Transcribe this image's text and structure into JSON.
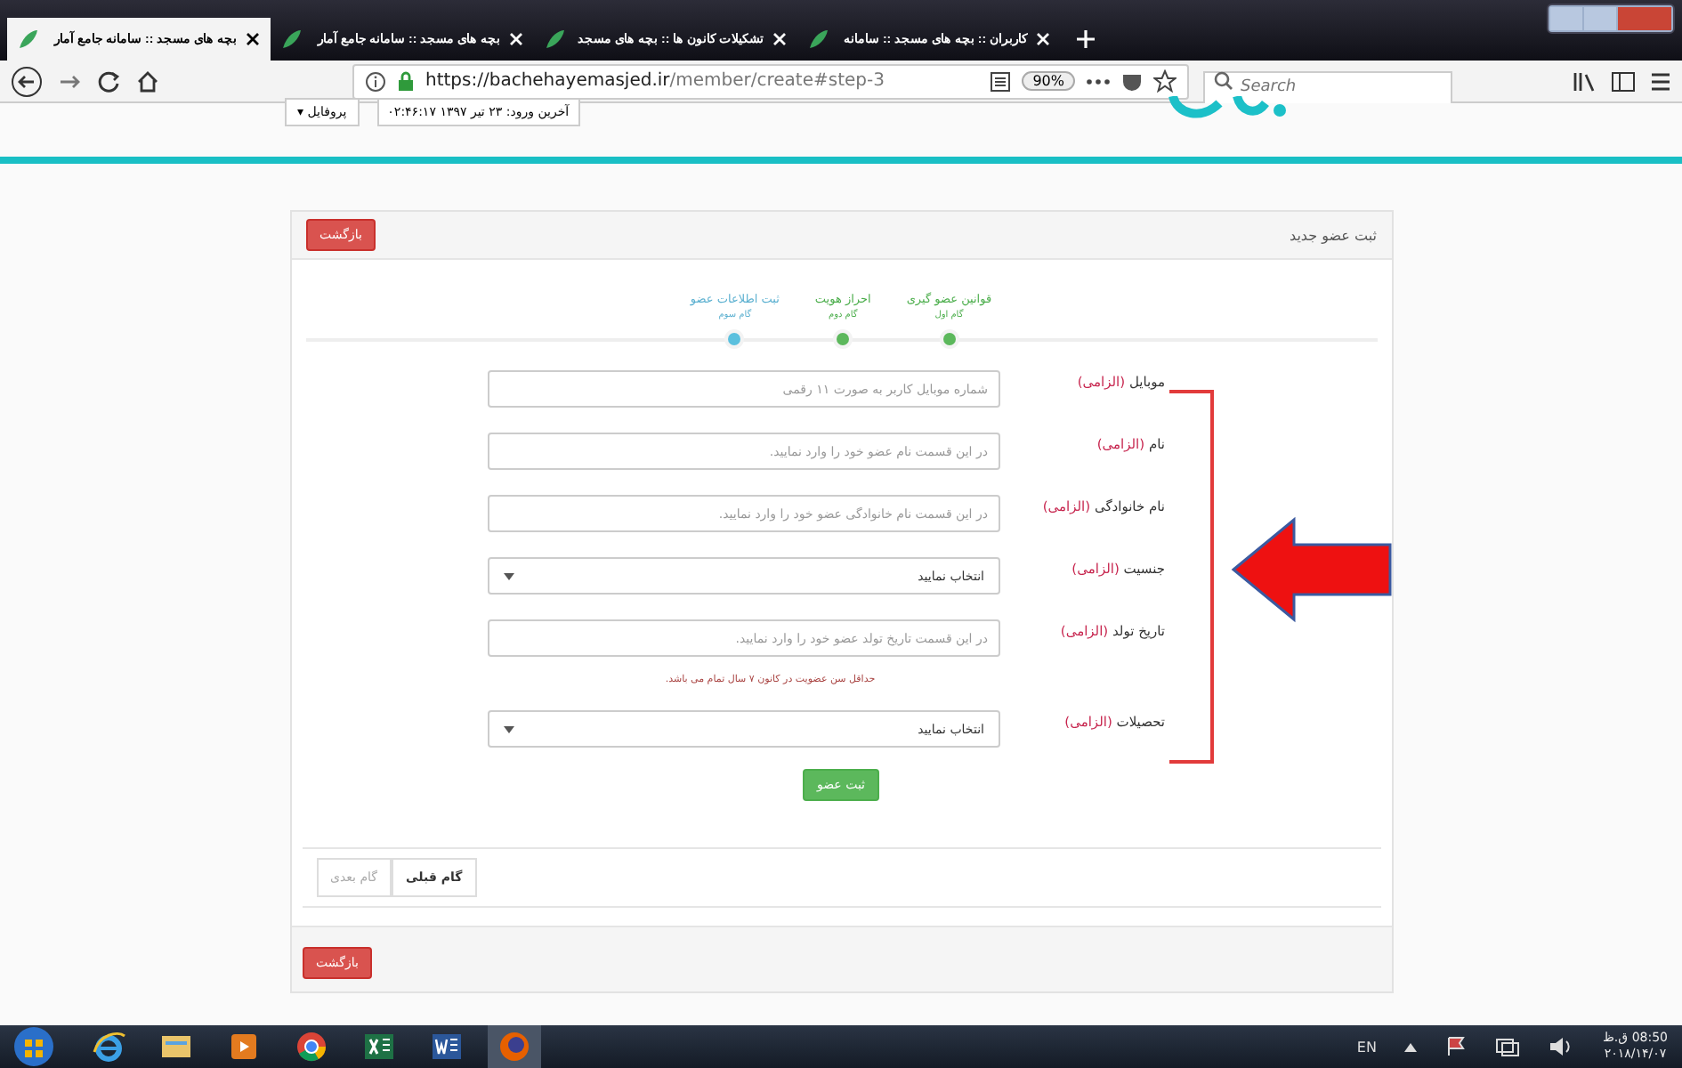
{
  "browser": {
    "tabs": [
      {
        "title": "کاربران :: بچه های مسجد :: سامانه",
        "selected": false
      },
      {
        "title": "تشکیلات کانون ها :: بچه های مسجد",
        "selected": false
      },
      {
        "title": "بچه های مسجد :: سامانه جامع آمار",
        "selected": false
      },
      {
        "title": "بچه های مسجد :: سامانه جامع آمار",
        "selected": true
      }
    ],
    "url_host": "https://bachehayemasjed.ir",
    "url_path": "/member/create#step-3",
    "zoom": "90%",
    "search": {
      "placeholder": "Search"
    }
  },
  "site_header": {
    "profile_button": "پروفایل ▾",
    "last_login": "آخرین ورود: ۲۳ تیر ۱۳۹۷ ۰۲:۴۶:۱۷"
  },
  "card": {
    "title": "ثبت عضو جدید",
    "back_button": "بازگشت",
    "steps": [
      {
        "title": "قوانین عضو گیری",
        "subtitle": "گام اول",
        "completed": true
      },
      {
        "title": "احراز هویت",
        "subtitle": "گام دوم",
        "completed": true
      },
      {
        "title": "ثبت اطلاعات عضو",
        "subtitle": "گام سوم",
        "completed": false
      }
    ],
    "fields": [
      {
        "kind": "input",
        "label": "موبایل",
        "required": "(الزامی)",
        "placeholder": "شماره موبایل کاربر به صورت ۱۱ رقمی"
      },
      {
        "kind": "input",
        "label": "نام",
        "required": "(الزامی)",
        "placeholder": "در این قسمت نام عضو خود را وارد نمایید."
      },
      {
        "kind": "input",
        "label": "نام خانوادگی",
        "required": "(الزامی)",
        "placeholder": "در این قسمت نام خانوادگی عضو خود را وارد نمایید."
      },
      {
        "kind": "select",
        "label": "جنسیت",
        "required": "(الزامی)",
        "value": "انتخاب نمایید"
      },
      {
        "kind": "input",
        "label": "تاریخ تولد",
        "required": "(الزامی)",
        "placeholder": "در این قسمت تاریخ تولد عضو خود را وارد نمایید.",
        "hint": "حداقل سن عضویت در کانون ۷ سال تمام می باشد."
      },
      {
        "kind": "select",
        "label": "تحصیلات",
        "required": "(الزامی)",
        "value": "انتخاب نمایید"
      }
    ],
    "submit_button": "ثبت عضو",
    "pager": [
      {
        "label": "گام قبلی",
        "disabled": false
      },
      {
        "label": "گام بعدی",
        "disabled": true
      }
    ],
    "footer_button": "بازگشت"
  },
  "taskbar": {
    "apps": [
      {
        "kind": "ie",
        "active": false
      },
      {
        "kind": "folder",
        "active": false
      },
      {
        "kind": "media",
        "active": false
      },
      {
        "kind": "chrome",
        "active": false
      },
      {
        "kind": "excel",
        "active": false
      },
      {
        "kind": "word",
        "active": false
      },
      {
        "kind": "firefox",
        "active": true
      }
    ],
    "language": "EN",
    "time": "08:50 ق.ظ",
    "date": "۲۰۱۸/۱۴/۰۷"
  }
}
